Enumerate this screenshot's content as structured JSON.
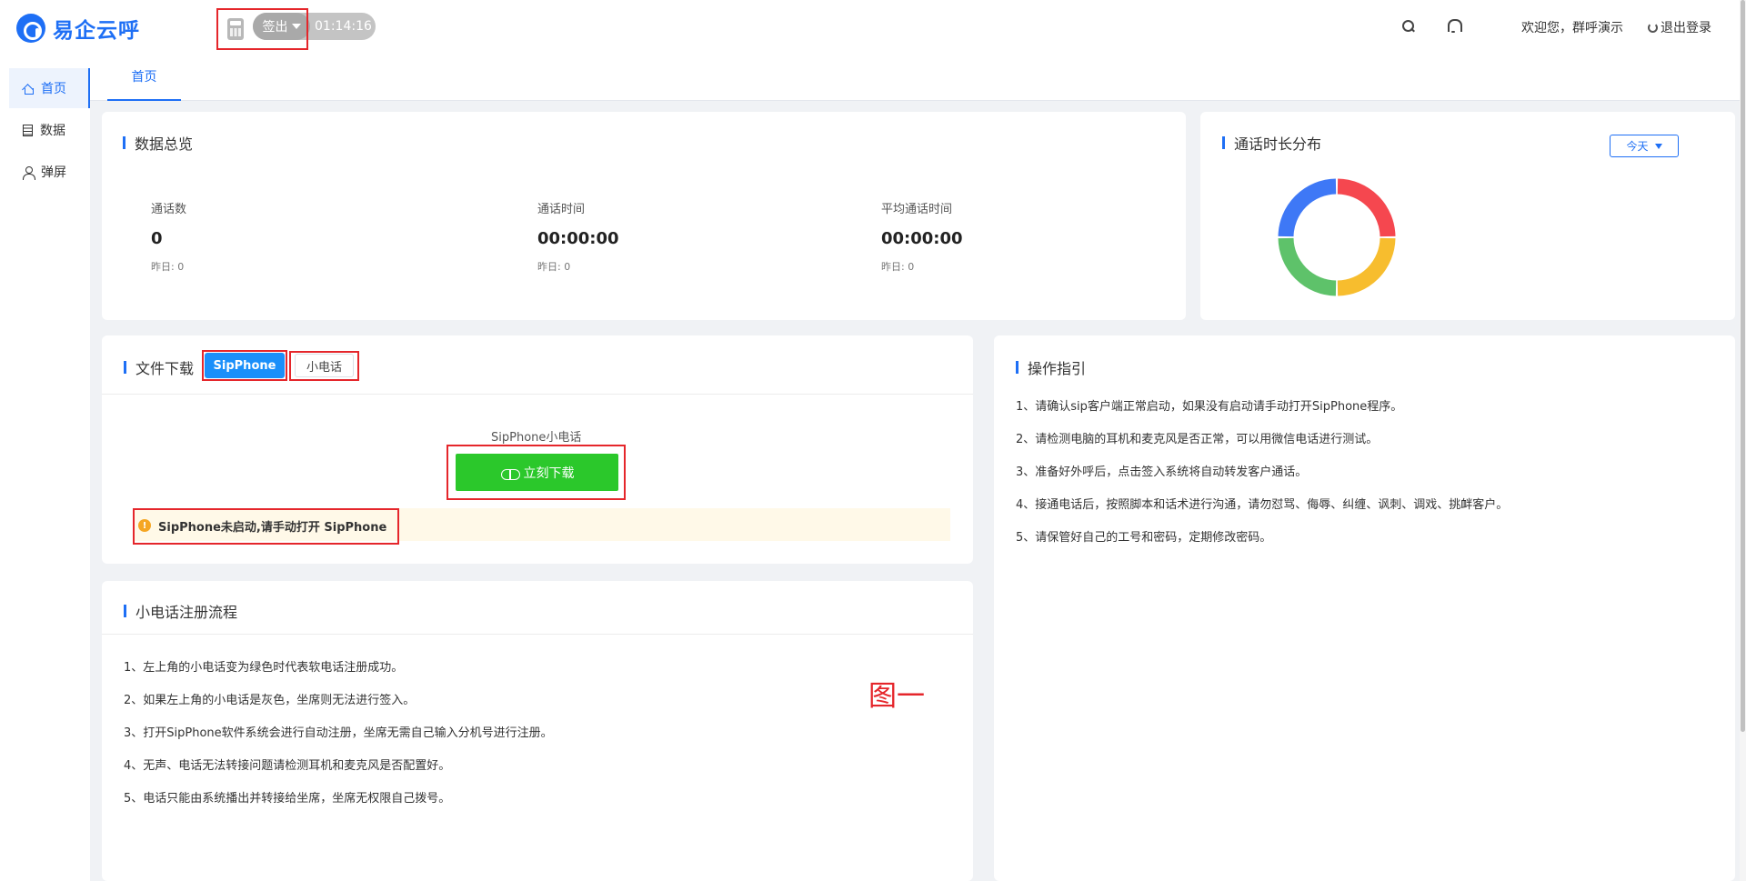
{
  "app": {
    "logo_text": "易企云呼"
  },
  "header": {
    "signout_label": "签出",
    "timer": "01:14:16",
    "welcome": "欢迎您，群呼演示",
    "logout_label": "退出登录"
  },
  "sidebar": {
    "items": [
      {
        "label": "首页",
        "icon": "home-icon",
        "active": true
      },
      {
        "label": "数据",
        "icon": "data-icon"
      },
      {
        "label": "弹屏",
        "icon": "user-icon"
      }
    ]
  },
  "tabs": [
    {
      "label": "首页",
      "active": true
    }
  ],
  "overview": {
    "title": "数据总览",
    "stats": [
      {
        "label": "通话数",
        "value": "0",
        "yesterday": "昨日: 0"
      },
      {
        "label": "通话时间",
        "value": "00:00:00",
        "yesterday": "昨日: 0"
      },
      {
        "label": "平均通话时间",
        "value": "00:00:00",
        "yesterday": "昨日: 0"
      }
    ]
  },
  "duration": {
    "title": "通话时长分布",
    "range_label": "今天",
    "segment_colors": [
      "#f5474f",
      "#f7bd2e",
      "#5ec26a",
      "#3e78f6"
    ]
  },
  "download": {
    "title": "文件下载",
    "tabs": [
      "SipPhone",
      "小电话"
    ],
    "caption": "SipPhone小电话",
    "button_label": "立刻下载",
    "warning": "SipPhone未启动,请手动打开 SipPhone"
  },
  "guide": {
    "title": "操作指引",
    "lines": [
      "1、请确认sip客户端正常启动，如果没有启动请手动打开SipPhone程序。",
      "2、请检测电脑的耳机和麦克风是否正常，可以用微信电话进行测试。",
      "3、准备好外呼后，点击签入系统将自动转发客户通话。",
      "4、接通电话后，按照脚本和话术进行沟通，请勿怼骂、侮辱、纠缠、讽刺、调戏、挑衅客户。",
      "5、请保管好自己的工号和密码，定期修改密码。"
    ]
  },
  "register": {
    "title": "小电话注册流程",
    "lines": [
      "1、左上角的小电话变为绿色时代表软电话注册成功。",
      "2、如果左上角的小电话是灰色，坐席则无法进行签入。",
      "3、打开SipPhone软件系统会进行自动注册，坐席无需自己输入分机号进行注册。",
      "4、无声、电话无法转接问题请检测耳机和麦克风是否配置好。",
      "5、电话只能由系统播出并转接给坐席，坐席无权限自己拨号。"
    ]
  },
  "annotation": "图一",
  "colors": {
    "accent": "#1e6ff5",
    "download_green": "#2bc82b",
    "highlight_red": "#e5262b"
  }
}
